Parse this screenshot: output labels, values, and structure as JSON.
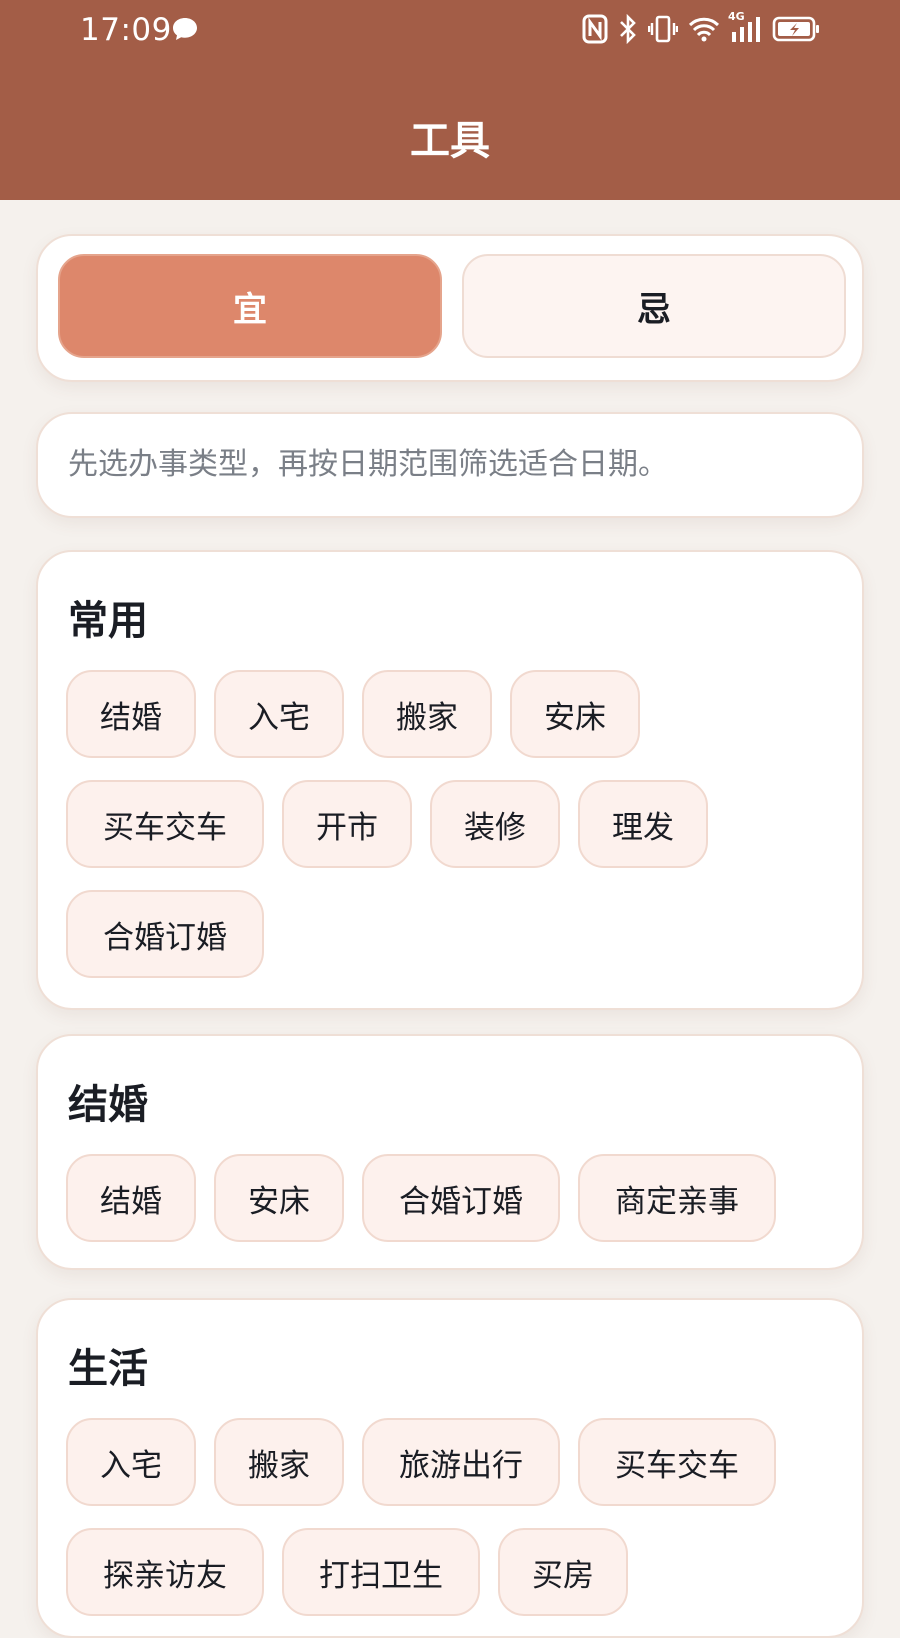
{
  "status_bar": {
    "time": "17:09",
    "network": "4G"
  },
  "header": {
    "title": "工具"
  },
  "mode_toggle": {
    "yi_label": "宜",
    "ji_label": "忌"
  },
  "hint": {
    "text": "先选办事类型，再按日期范围筛选适合日期。"
  },
  "sections": [
    {
      "title": "常用",
      "chips": [
        "结婚",
        "入宅",
        "搬家",
        "安床",
        "买车交车",
        "开市",
        "装修",
        "理发",
        "合婚订婚"
      ]
    },
    {
      "title": "结婚",
      "chips": [
        "结婚",
        "安床",
        "合婚订婚",
        "商定亲事"
      ]
    },
    {
      "title": "生活",
      "chips": [
        "入宅",
        "搬家",
        "旅游出行",
        "买车交车",
        "探亲访友",
        "打扫卫生",
        "买房"
      ]
    }
  ],
  "colors": {
    "header": "#a35d47",
    "accent": "#dd876b",
    "chip_bg": "#fdf1ed",
    "page_bg": "#f5f1ed"
  }
}
